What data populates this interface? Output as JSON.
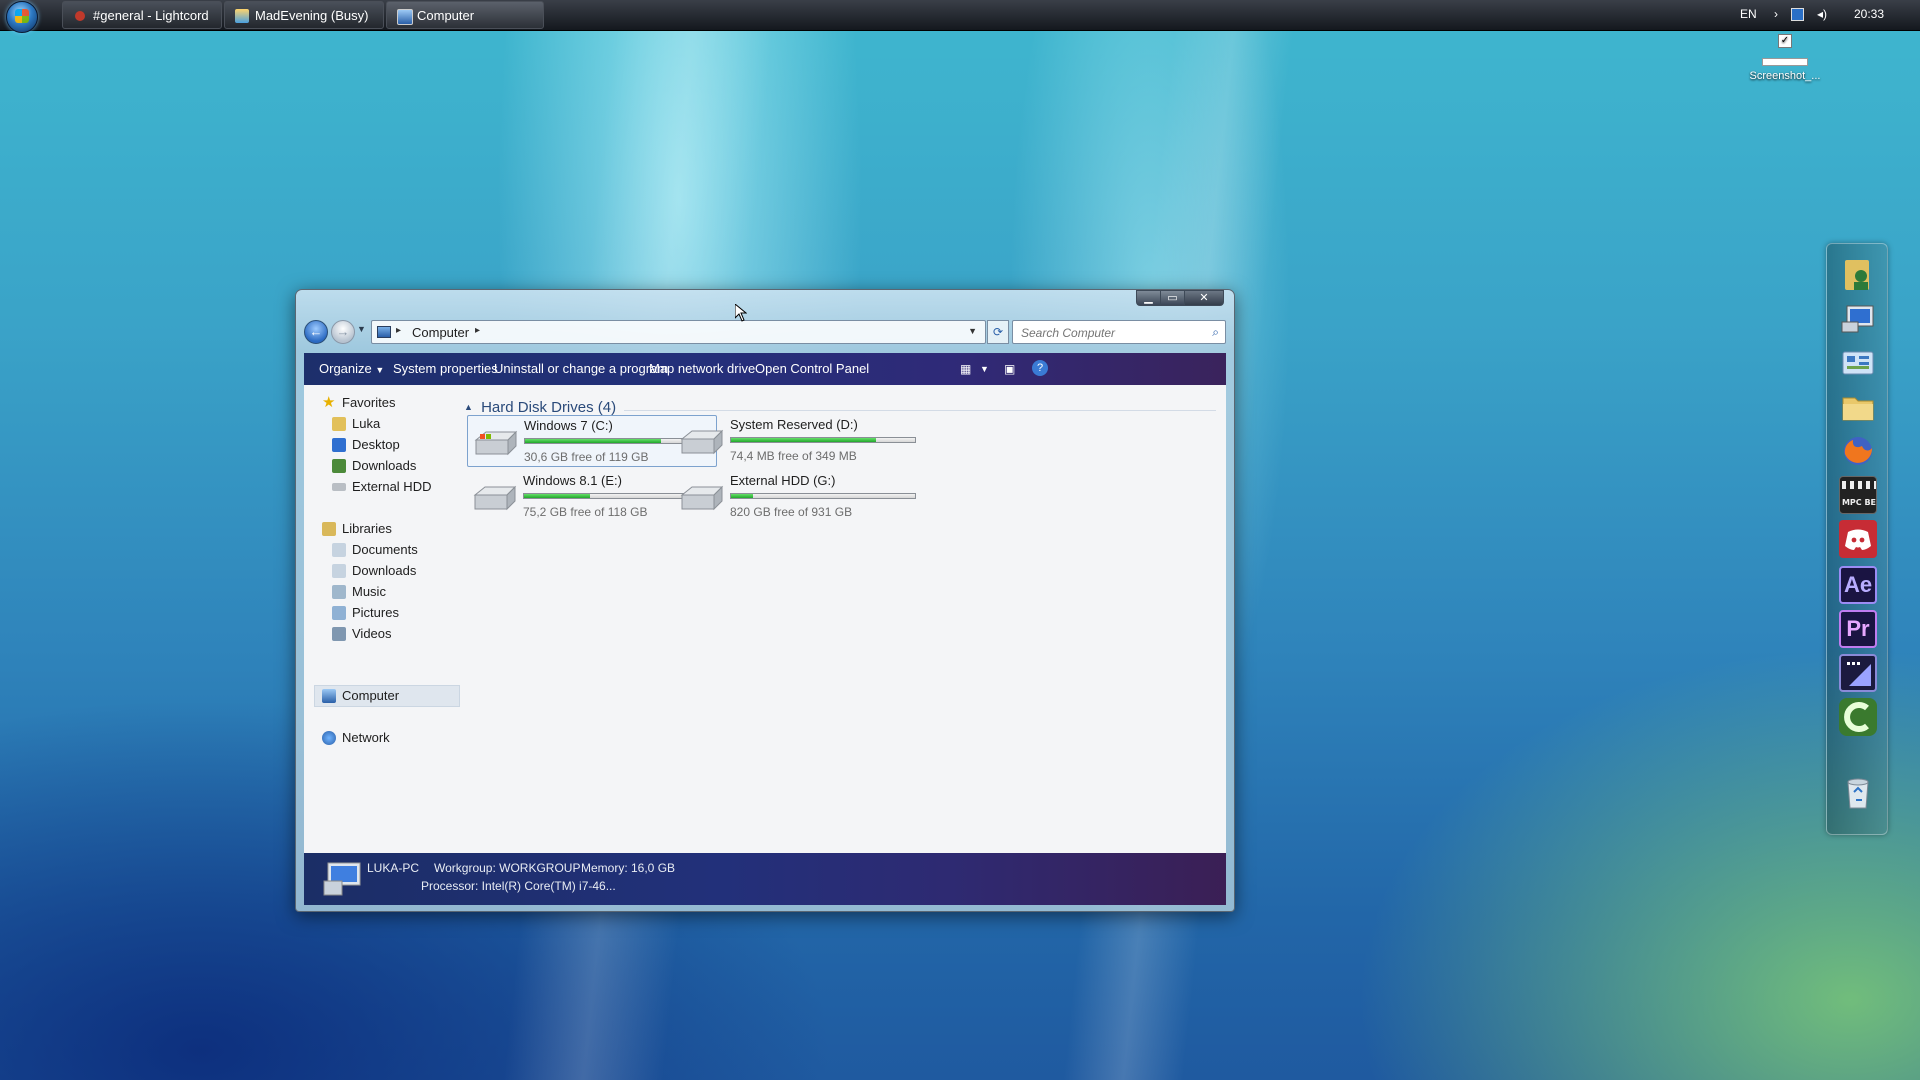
{
  "taskbar": {
    "tasks": [
      {
        "label": "#general - Lightcord"
      },
      {
        "label": "MadEvening (Busy)"
      },
      {
        "label": "Computer"
      }
    ],
    "language": "EN",
    "clock": "20:33"
  },
  "desktop": {
    "screenshot_label": "Screenshot_...",
    "checkbox_mark": "✓"
  },
  "dock": {
    "ae_label": "Ae",
    "pr_label": "Pr",
    "mpc_label": "MPC BE"
  },
  "window": {
    "breadcrumb": "Computer",
    "search_placeholder": "Search Computer",
    "commands": {
      "organize": "Organize",
      "system_properties": "System properties",
      "uninstall": "Uninstall or change a program",
      "map_drive": "Map network drive",
      "control_panel": "Open Control Panel"
    },
    "navpane": {
      "favorites": "Favorites",
      "fav_items": [
        "Luka",
        "Desktop",
        "Downloads",
        "External HDD"
      ],
      "libraries": "Libraries",
      "lib_items": [
        "Documents",
        "Downloads",
        "Music",
        "Pictures",
        "Videos"
      ],
      "computer": "Computer",
      "network": "Network"
    },
    "group_header": "Hard Disk Drives (4)",
    "drives": [
      {
        "name": "Windows 7 (C:)",
        "free": "30,6 GB free of 119 GB",
        "used_fraction": 0.74
      },
      {
        "name": "System Reserved (D:)",
        "free": "74,4 MB free of 349 MB",
        "used_fraction": 0.79
      },
      {
        "name": "Windows 8.1 (E:)",
        "free": "75,2 GB free of 118 GB",
        "used_fraction": 0.36
      },
      {
        "name": "External HDD (G:)",
        "free": "820 GB free of 931 GB",
        "used_fraction": 0.12
      }
    ],
    "details": {
      "pc_name": "LUKA-PC",
      "workgroup": "Workgroup: WORKGROUP",
      "memory": "Memory: 16,0 GB",
      "processor": "Processor: Intel(R) Core(TM) i7-46..."
    }
  },
  "colors": {
    "drive_fill": "#2ec436",
    "command_bar": "#23307a"
  }
}
